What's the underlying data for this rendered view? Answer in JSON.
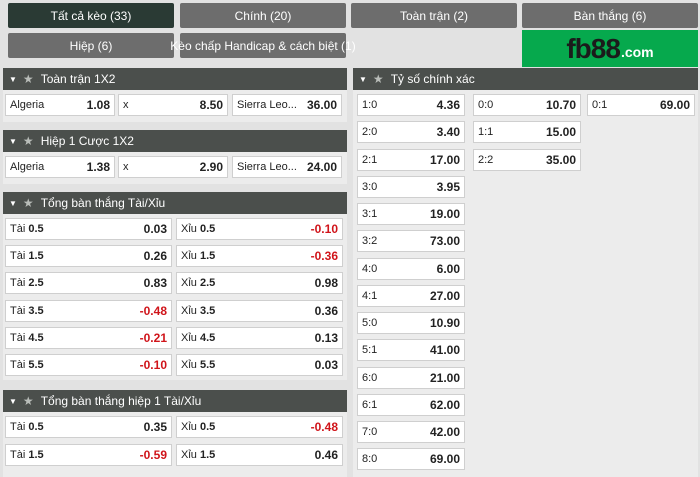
{
  "tabs": [
    {
      "label": "Tất cả kèo (33)"
    },
    {
      "label": "Chính (20)"
    },
    {
      "label": "Toàn trận (2)"
    },
    {
      "label": "Bàn thắng (6)"
    },
    {
      "label": "Hiệp (6)"
    },
    {
      "label": "Kèo chấp Handicap & cách biệt (1)"
    }
  ],
  "logo": {
    "brand": "fb88",
    "domain": ".com"
  },
  "sections": {
    "ft1x2": {
      "title": "Toàn trận 1X2",
      "odds": [
        {
          "label": "Algeria",
          "value": "1.08"
        },
        {
          "label": "x",
          "value": "8.50"
        },
        {
          "label": "Sierra Leo...",
          "value": "36.00"
        }
      ]
    },
    "h1x2": {
      "title": "Hiệp 1 Cược 1X2",
      "odds": [
        {
          "label": "Algeria",
          "value": "1.38"
        },
        {
          "label": "x",
          "value": "2.90"
        },
        {
          "label": "Sierra Leo...",
          "value": "24.00"
        }
      ]
    },
    "ou": {
      "title": "Tổng bàn thắng Tài/Xỉu",
      "rows": [
        {
          "over_label": "Tài",
          "line": "0.5",
          "over": "0.03",
          "under_label": "Xỉu",
          "under_line": "0.5",
          "under": "-0.10"
        },
        {
          "over_label": "Tài",
          "line": "1.5",
          "over": "0.26",
          "under_label": "Xỉu",
          "under_line": "1.5",
          "under": "-0.36"
        },
        {
          "over_label": "Tài",
          "line": "2.5",
          "over": "0.83",
          "under_label": "Xỉu",
          "under_line": "2.5",
          "under": "0.98"
        },
        {
          "over_label": "Tài",
          "line": "3.5",
          "over": "-0.48",
          "under_label": "Xỉu",
          "under_line": "3.5",
          "under": "0.36"
        },
        {
          "over_label": "Tài",
          "line": "4.5",
          "over": "-0.21",
          "under_label": "Xỉu",
          "under_line": "4.5",
          "under": "0.13"
        },
        {
          "over_label": "Tài",
          "line": "5.5",
          "over": "-0.10",
          "under_label": "Xỉu",
          "under_line": "5.5",
          "under": "0.03"
        }
      ]
    },
    "ou_h1": {
      "title": "Tổng bàn thắng hiệp 1 Tài/Xỉu",
      "rows": [
        {
          "over_label": "Tài",
          "line": "0.5",
          "over": "0.35",
          "under_label": "Xỉu",
          "under_line": "0.5",
          "under": "-0.48"
        },
        {
          "over_label": "Tài",
          "line": "1.5",
          "over": "-0.59",
          "under_label": "Xỉu",
          "under_line": "1.5",
          "under": "0.46"
        }
      ]
    },
    "cs": {
      "title": "Tỷ số chính xác",
      "col1": [
        {
          "score": "1:0",
          "value": "4.36"
        },
        {
          "score": "2:0",
          "value": "3.40"
        },
        {
          "score": "2:1",
          "value": "17.00"
        },
        {
          "score": "3:0",
          "value": "3.95"
        },
        {
          "score": "3:1",
          "value": "19.00"
        },
        {
          "score": "3:2",
          "value": "73.00"
        },
        {
          "score": "4:0",
          "value": "6.00"
        },
        {
          "score": "4:1",
          "value": "27.00"
        },
        {
          "score": "5:0",
          "value": "10.90"
        },
        {
          "score": "5:1",
          "value": "41.00"
        },
        {
          "score": "6:0",
          "value": "21.00"
        },
        {
          "score": "6:1",
          "value": "62.00"
        },
        {
          "score": "7:0",
          "value": "42.00"
        },
        {
          "score": "8:0",
          "value": "69.00"
        }
      ],
      "col2": [
        {
          "score": "0:0",
          "value": "10.70"
        },
        {
          "score": "1:1",
          "value": "15.00"
        },
        {
          "score": "2:2",
          "value": "35.00"
        }
      ],
      "col3": [
        {
          "score": "0:1",
          "value": "69.00"
        }
      ]
    }
  }
}
